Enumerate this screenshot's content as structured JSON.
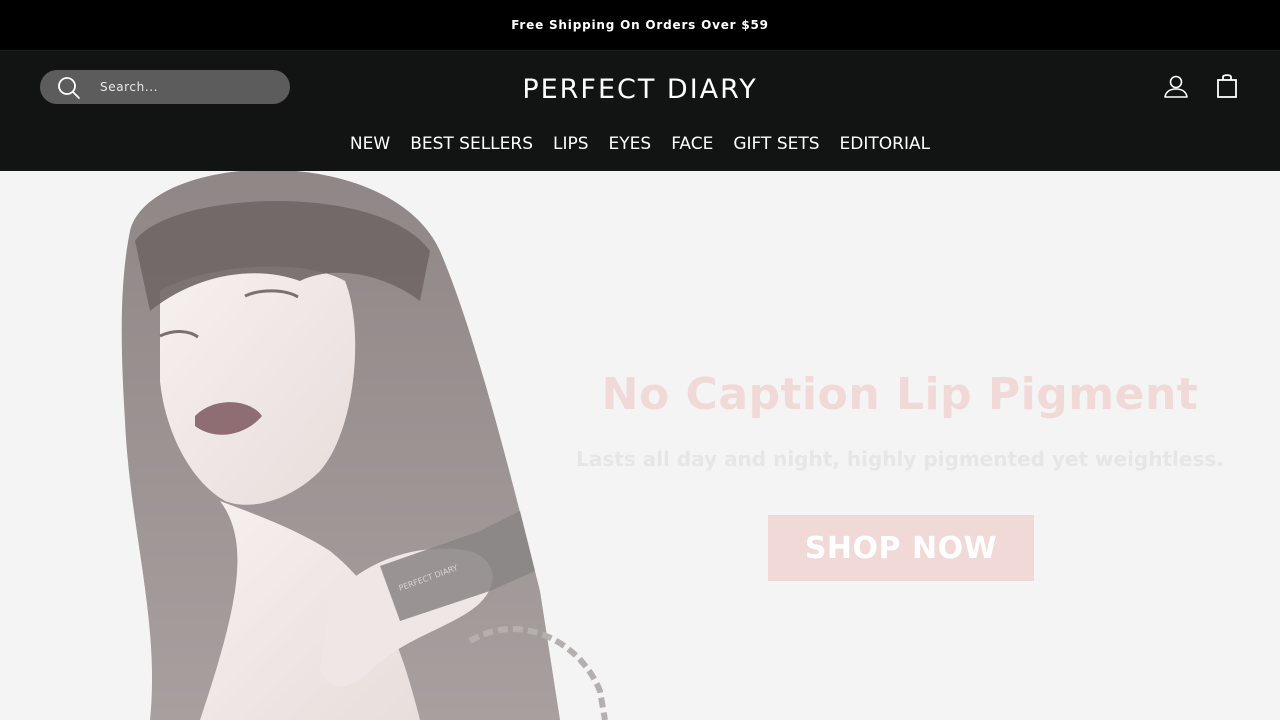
{
  "announcement": {
    "text": "Free Shipping On Orders Over $59"
  },
  "header": {
    "search": {
      "placeholder": "Search..."
    },
    "logo": "PERFECT DIARY",
    "icons": {
      "search": "search-icon",
      "account": "user-icon",
      "cart": "shopping-bag-icon"
    }
  },
  "nav": {
    "items": [
      "NEW",
      "BEST SELLERS",
      "LIPS",
      "EYES",
      "FACE",
      "GIFT SETS",
      "EDITORIAL"
    ]
  },
  "hero": {
    "title": "No Caption Lip Pigment",
    "subtitle": "Lasts all day and night, highly pigmented yet weightless.",
    "cta_label": "SHOP NOW",
    "product_text": "PERFECT DIARY"
  },
  "colors": {
    "announcement_bg": "#000000",
    "header_bg": "#121413",
    "search_bg": "#5c5c5c",
    "hero_bg": "#f4f4f4",
    "accent_pink": "#f1d9d8"
  }
}
